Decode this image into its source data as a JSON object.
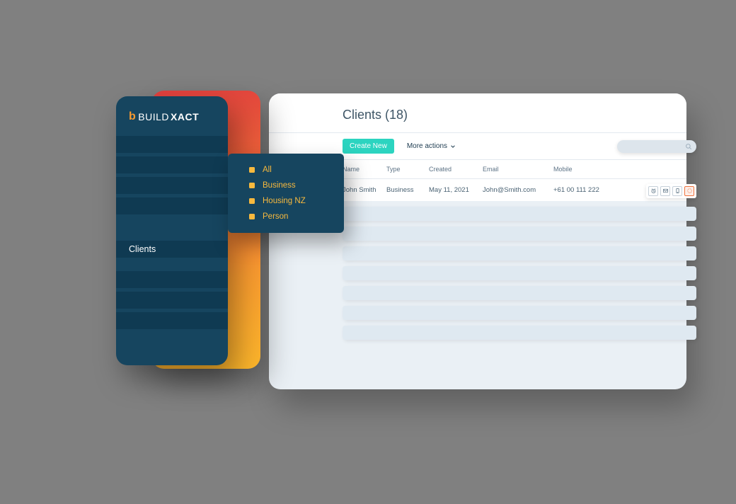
{
  "brand": {
    "build": "BUILD",
    "xact": "XACT"
  },
  "sidebar": {
    "active_label": "Clients"
  },
  "submenu": {
    "items": [
      {
        "label": "All"
      },
      {
        "label": "Business"
      },
      {
        "label": "Housing NZ"
      },
      {
        "label": "Person"
      }
    ]
  },
  "main": {
    "title": "Clients (18)",
    "create_label": "Create New",
    "more_actions_label": "More actions",
    "columns": {
      "name": "Name",
      "type": "Type",
      "created": "Created",
      "email": "Email",
      "mobile": "Mobile"
    },
    "rows": [
      {
        "name": "John Smith",
        "type": "Business",
        "created": "May 11, 2021",
        "email": "John@Smith.com",
        "mobile": "+61 00 111 222"
      }
    ]
  }
}
